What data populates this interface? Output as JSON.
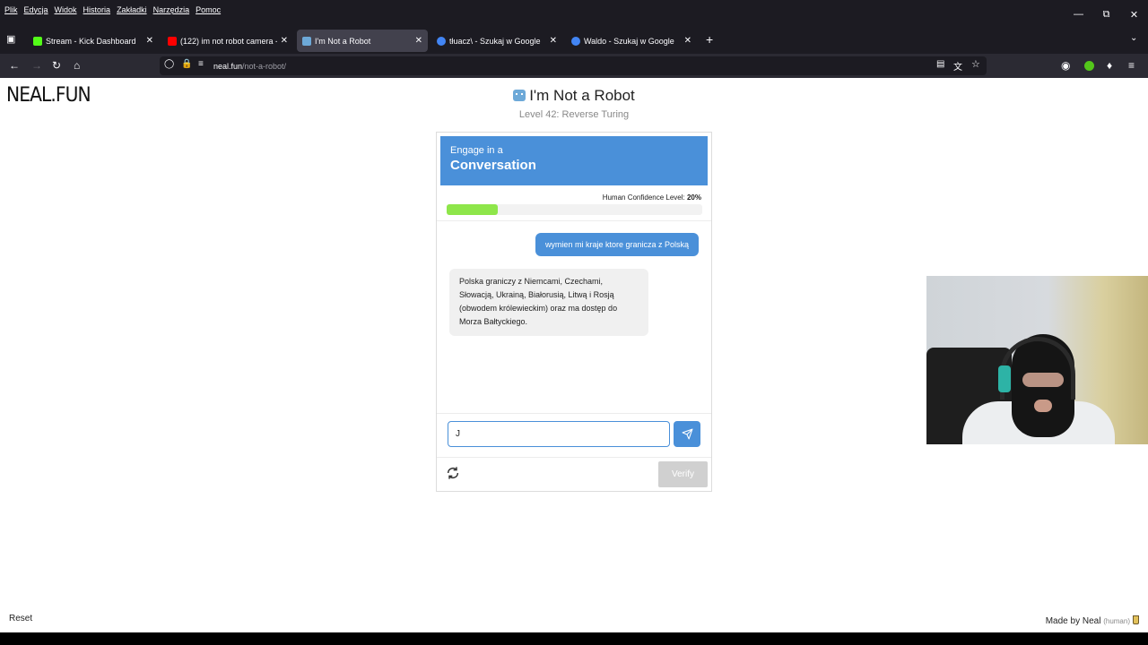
{
  "menubar": {
    "items": [
      "Plik",
      "Edycja",
      "Widok",
      "Historia",
      "Zakładki",
      "Narzędzia",
      "Pomoc"
    ]
  },
  "tabs": [
    {
      "title": "Stream - Kick Dashboard",
      "color": "#53fc18",
      "active": false
    },
    {
      "title": "(122) im not robot camera - You",
      "color": "#ff0000",
      "active": false
    },
    {
      "title": "I'm Not a Robot",
      "color": "#6da9d8",
      "active": true
    },
    {
      "title": "tłuacz\\ - Szukaj w Google",
      "color": "#4285f4",
      "active": false
    },
    {
      "title": "Waldo - Szukaj w Google",
      "color": "#4285f4",
      "active": false
    }
  ],
  "address": {
    "host": "neal.fun",
    "path": "/not-a-robot/"
  },
  "page": {
    "logo": "NEAL.FUN",
    "title": "I'm Not a Robot",
    "subtitle": "Level 42: Reverse Turing"
  },
  "card": {
    "head_small": "Engage in a",
    "head_big": "Conversation",
    "confidence_label": "Human Confidence Level:",
    "confidence_value": "20%",
    "confidence_fraction": 0.2,
    "user_message": "wymien mi kraje ktore granicza z Polską",
    "bot_message": "Polska graniczy z Niemcami, Czechami, Słowacją, Ukrainą, Białorusią, Litwą i Rosją (obwodem królewieckim) oraz ma dostęp do Morza Bałtyckiego.",
    "input_value": "J",
    "verify_label": "Verify"
  },
  "footer": {
    "reset_label": "Reset",
    "made_by": "Made by Neal",
    "human_tag": "(human)"
  },
  "colors": {
    "accent": "#4a90d9",
    "progress": "#8ee64a"
  }
}
